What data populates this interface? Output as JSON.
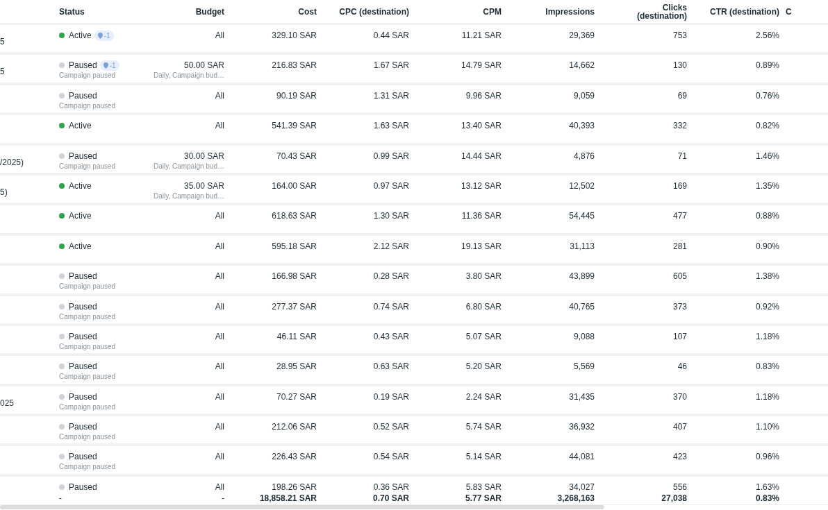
{
  "table": {
    "columns": [
      {
        "label": "Status"
      },
      {
        "label": "Budget"
      },
      {
        "label": "Cost"
      },
      {
        "label": "CPC (destination)"
      },
      {
        "label": "CPM"
      },
      {
        "label": "Impressions"
      },
      {
        "label": "Clicks (destination)"
      },
      {
        "label": "CTR (destination)"
      },
      {
        "label": "C"
      }
    ],
    "rows": [
      {
        "name": "5",
        "active": true,
        "status_label": "Active",
        "badge": "-1",
        "budget": "All",
        "cost": "329.10 SAR",
        "cpc": "0.44 SAR",
        "cpm": "11.21 SAR",
        "impressions": "29,369",
        "clicks": "753",
        "ctr": "2.56%"
      },
      {
        "name": "5",
        "active": false,
        "status_label": "Paused",
        "badge": "-1",
        "status_note": "Campaign paused",
        "budget": "50.00 SAR",
        "budget_note": "Daily, Campaign bud…",
        "cost": "216.83 SAR",
        "cpc": "1.67 SAR",
        "cpm": "14.79 SAR",
        "impressions": "14,662",
        "clicks": "130",
        "ctr": "0.89%"
      },
      {
        "active": false,
        "status_label": "Paused",
        "status_note": "Campaign paused",
        "budget": "All",
        "cost": "90.19 SAR",
        "cpc": "1.31 SAR",
        "cpm": "9.96 SAR",
        "impressions": "9,059",
        "clicks": "69",
        "ctr": "0.76%"
      },
      {
        "active": true,
        "status_label": "Active",
        "budget": "All",
        "cost": "541.39 SAR",
        "cpc": "1.63 SAR",
        "cpm": "13.40 SAR",
        "impressions": "40,393",
        "clicks": "332",
        "ctr": "0.82%"
      },
      {
        "name": "/2025)",
        "active": false,
        "status_label": "Paused",
        "status_note": "Campaign paused",
        "budget": "30.00 SAR",
        "budget_note": "Daily, Campaign bud…",
        "cost": "70.43 SAR",
        "cpc": "0.99 SAR",
        "cpm": "14.44 SAR",
        "impressions": "4,876",
        "clicks": "71",
        "ctr": "1.46%"
      },
      {
        "name": "5)",
        "active": true,
        "status_label": "Active",
        "budget": "35.00 SAR",
        "budget_note": "Daily, Campaign bud…",
        "cost": "164.00 SAR",
        "cpc": "0.97 SAR",
        "cpm": "13.12 SAR",
        "impressions": "12,502",
        "clicks": "169",
        "ctr": "1.35%"
      },
      {
        "active": true,
        "status_label": "Active",
        "budget": "All",
        "cost": "618.63 SAR",
        "cpc": "1.30 SAR",
        "cpm": "11.36 SAR",
        "impressions": "54,445",
        "clicks": "477",
        "ctr": "0.88%"
      },
      {
        "active": true,
        "status_label": "Active",
        "budget": "All",
        "cost": "595.18 SAR",
        "cpc": "2.12 SAR",
        "cpm": "19.13 SAR",
        "impressions": "31,113",
        "clicks": "281",
        "ctr": "0.90%"
      },
      {
        "active": false,
        "status_label": "Paused",
        "status_note": "Campaign paused",
        "budget": "All",
        "cost": "166.98 SAR",
        "cpc": "0.28 SAR",
        "cpm": "3.80 SAR",
        "impressions": "43,899",
        "clicks": "605",
        "ctr": "1.38%"
      },
      {
        "active": false,
        "status_label": "Paused",
        "status_note": "Campaign paused",
        "budget": "All",
        "cost": "277.37 SAR",
        "cpc": "0.74 SAR",
        "cpm": "6.80 SAR",
        "impressions": "40,765",
        "clicks": "373",
        "ctr": "0.92%"
      },
      {
        "active": false,
        "status_label": "Paused",
        "status_note": "Campaign paused",
        "budget": "All",
        "cost": "46.11 SAR",
        "cpc": "0.43 SAR",
        "cpm": "5.07 SAR",
        "impressions": "9,088",
        "clicks": "107",
        "ctr": "1.18%"
      },
      {
        "active": false,
        "status_label": "Paused",
        "status_note": "Campaign paused",
        "budget": "All",
        "cost": "28.95 SAR",
        "cpc": "0.63 SAR",
        "cpm": "5.20 SAR",
        "impressions": "5,569",
        "clicks": "46",
        "ctr": "0.83%"
      },
      {
        "name": "025",
        "active": false,
        "status_label": "Paused",
        "status_note": "Campaign paused",
        "budget": "All",
        "cost": "70.27 SAR",
        "cpc": "0.19 SAR",
        "cpm": "2.24 SAR",
        "impressions": "31,435",
        "clicks": "370",
        "ctr": "1.18%"
      },
      {
        "active": false,
        "status_label": "Paused",
        "status_note": "Campaign paused",
        "budget": "All",
        "cost": "212.06 SAR",
        "cpc": "0.52 SAR",
        "cpm": "5.74 SAR",
        "impressions": "36,932",
        "clicks": "407",
        "ctr": "1.10%"
      },
      {
        "active": false,
        "status_label": "Paused",
        "status_note": "Campaign paused",
        "budget": "All",
        "cost": "226.43 SAR",
        "cpc": "0.54 SAR",
        "cpm": "5.14 SAR",
        "impressions": "44,081",
        "clicks": "423",
        "ctr": "0.96%"
      },
      {
        "active": false,
        "status_label": "Paused",
        "budget": "All",
        "cost": "198.26 SAR",
        "cpc": "0.36 SAR",
        "cpm": "5.83 SAR",
        "impressions": "34,027",
        "clicks": "556",
        "ctr": "1.63%"
      }
    ],
    "totals": {
      "status": "-",
      "budget": "-",
      "cost": "18,858.21 SAR",
      "cpc": "0.70 SAR",
      "cpm": "5.77 SAR",
      "impressions": "3,268,163",
      "clicks": "27,038",
      "ctr": "0.83%"
    }
  }
}
